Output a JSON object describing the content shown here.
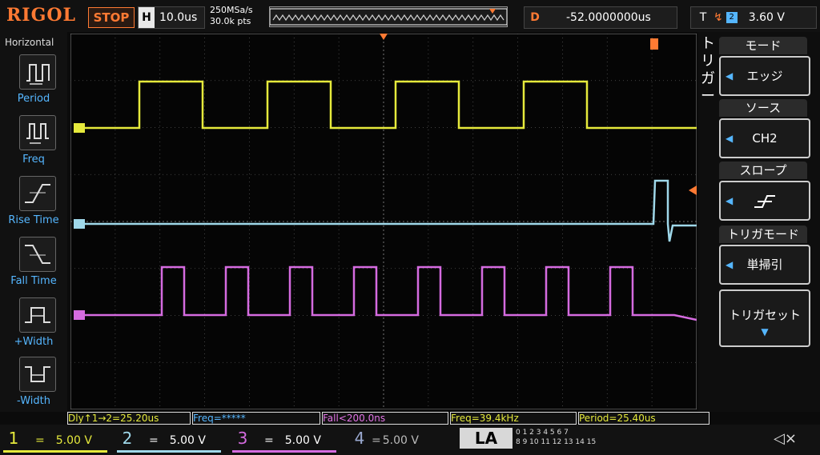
{
  "brand": "RIGOL",
  "run_state": "STOP",
  "horizontal": {
    "key": "H",
    "timebase": "10.0us"
  },
  "acquire": {
    "sample_rate": "250MSa/s",
    "points": "30.0k pts"
  },
  "delay": {
    "key": "D",
    "value": "-52.0000000us"
  },
  "trigger_status": {
    "key": "T",
    "level": "3.60 V"
  },
  "left_menu": {
    "title": "Horizontal",
    "items": [
      {
        "label": "Period",
        "icon": "period-icon"
      },
      {
        "label": "Freq",
        "icon": "freq-icon"
      },
      {
        "label": "Rise Time",
        "icon": "rise-time-icon"
      },
      {
        "label": "Fall Time",
        "icon": "fall-time-icon"
      },
      {
        "label": "+Width",
        "icon": "pos-width-icon"
      },
      {
        "label": "-Width",
        "icon": "neg-width-icon"
      }
    ]
  },
  "right_menu": {
    "title": "トリガー",
    "items": [
      {
        "head": "モード",
        "value": "エッジ"
      },
      {
        "head": "ソース",
        "value": "CH2"
      },
      {
        "head": "スロープ",
        "value": "rising-edge-icon"
      },
      {
        "head": "トリガモード",
        "value": "単掃引"
      }
    ],
    "preset": "トリガセット"
  },
  "measurements": [
    {
      "label": "Dly↑1→2=25.20us",
      "color": "#e6ea3c"
    },
    {
      "label": "Freq=*****",
      "color": "#55b6ff"
    },
    {
      "label": "Fall<200.0ns",
      "color": "#e274e6"
    },
    {
      "label": "Freq=39.4kHz",
      "color": "#e6ea3c"
    },
    {
      "label": "Period=25.40us",
      "color": "#e6ea3c"
    }
  ],
  "channels": [
    {
      "num": "1",
      "coupling": "=",
      "scale": "5.00 V",
      "color": "#e6ea3c"
    },
    {
      "num": "2",
      "coupling": "=",
      "scale": "5.00 V",
      "color": "#9fd8ea"
    },
    {
      "num": "3",
      "coupling": "=",
      "scale": "5.00 V",
      "color": "#d56be0"
    },
    {
      "num": "4",
      "coupling": "=",
      "scale": "5.00 V",
      "color": "#6f8fd8"
    }
  ],
  "la": {
    "label": "LA",
    "rows": [
      "0 1 2 3  4 5 6 7",
      "8 9 10 11  12 13 14 15"
    ]
  },
  "colors": {
    "ch1": "#e6ea3c",
    "ch2": "#9fd8ea",
    "ch3": "#d56be0",
    "trigger": "#ff7a33",
    "accent": "#55b6ff"
  }
}
